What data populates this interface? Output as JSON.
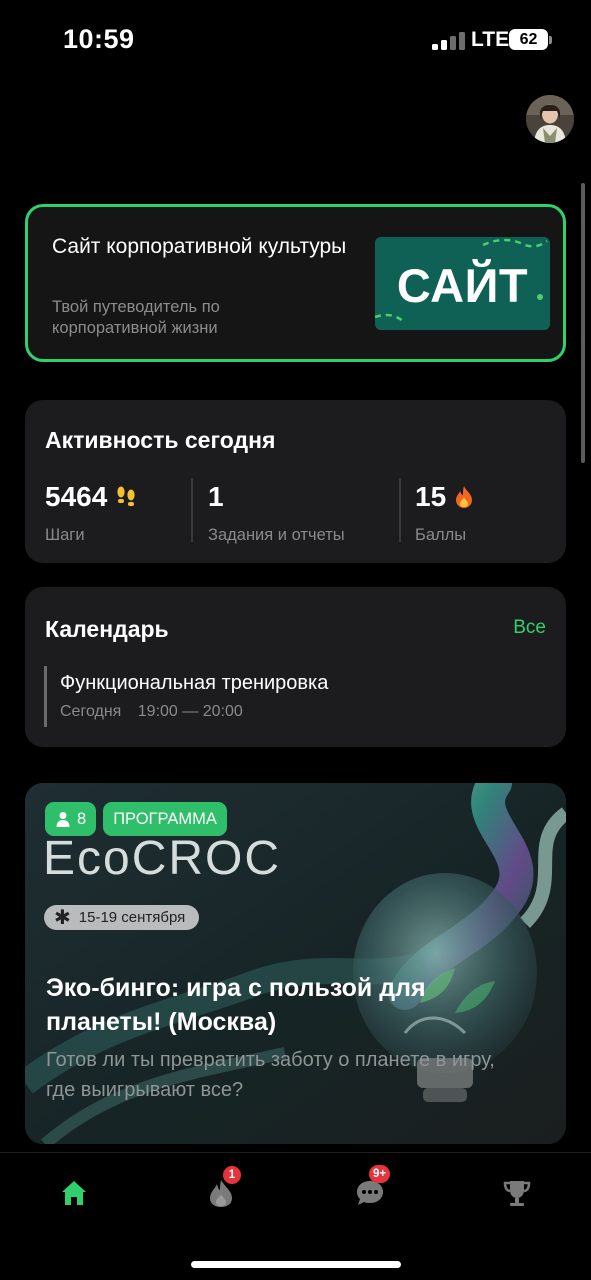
{
  "status_bar": {
    "time": "10:59",
    "network": "LTE",
    "battery": "62"
  },
  "profile": {
    "avatar_icon": "user-avatar"
  },
  "site_banner": {
    "title": "Сайт корпоративной культуры",
    "subtitle": "Твой путеводитель по корпоративной жизни",
    "thumbnail_text": "САЙТ"
  },
  "activity": {
    "title": "Активность сегодня",
    "stats": [
      {
        "value": "5464",
        "label": "Шаги",
        "icon": "footsteps-icon"
      },
      {
        "value": "1",
        "label": "Задания и отчеты"
      },
      {
        "value": "15",
        "label": "Баллы",
        "icon": "fire-icon"
      }
    ]
  },
  "calendar": {
    "title": "Календарь",
    "all_link": "Все",
    "event": {
      "title": "Функциональная тренировка",
      "day": "Сегодня",
      "time": "19:00 — 20:00"
    }
  },
  "promo": {
    "participants": "8",
    "tag": "ПРОГРАММА",
    "logo": "EcoCROC",
    "dates": "15-19 сентября",
    "title": "Эко-бинго: игра с пользой для планеты! (Москва)",
    "description": "Готов ли ты превратить заботу о планете в игру, где выигрывают все?"
  },
  "tab_bar": {
    "tabs": [
      {
        "name": "home",
        "icon": "home-icon",
        "active": true
      },
      {
        "name": "challenges",
        "icon": "flame-drop-icon",
        "badge": "1"
      },
      {
        "name": "chat",
        "icon": "chat-bubble-icon",
        "badge": "9+"
      },
      {
        "name": "rating",
        "icon": "trophy-icon"
      }
    ]
  },
  "colors": {
    "accent": "#2fd16f",
    "background": "#000000",
    "card": "#1c1c1e",
    "muted_text": "#8a8a8a",
    "badge_red": "#e5343b"
  }
}
